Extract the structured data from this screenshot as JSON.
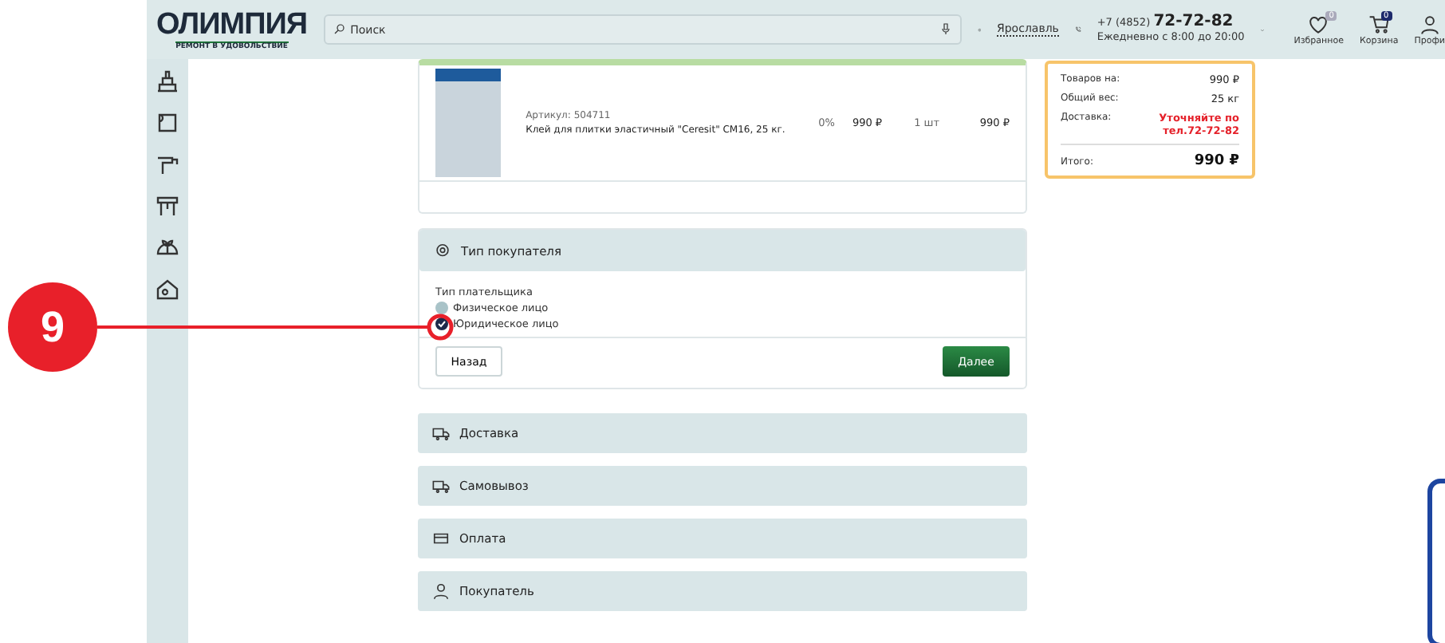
{
  "header": {
    "logo": "ОЛИМПИЯ",
    "tagline": "РЕМОНТ В УДОВОЛЬСТВИЕ",
    "search": {
      "placeholder": "Поиск"
    },
    "city": "Ярославль",
    "phone_prefix": "+7 (4852)",
    "phone": "72-72-82",
    "hours": "Ежедневно с 8:00 до 20:00",
    "actions": [
      {
        "kind": "favorites",
        "label": "Избранное",
        "badge": "0"
      },
      {
        "kind": "cart",
        "label": "Корзина",
        "badge": "0"
      },
      {
        "kind": "profile",
        "label": "Профи"
      }
    ]
  },
  "sidebar": {
    "items": [
      {
        "kind": "bricks"
      },
      {
        "kind": "wallpaper"
      },
      {
        "kind": "faucet"
      },
      {
        "kind": "tools"
      },
      {
        "kind": "garden"
      },
      {
        "kind": "house"
      }
    ]
  },
  "product": {
    "article": "Артикул: 504711",
    "name": "Клей для плитки эластичный \"Ceresit\" CM16, 25 кг.",
    "discount": "0%",
    "price": "990 ₽",
    "quantity": "1 шт",
    "total": "990 ₽"
  },
  "buyer_section": {
    "title": "Тип покупателя",
    "payer_label": "Тип плательщика",
    "options": [
      {
        "label": "Физическое лицо",
        "selected": false
      },
      {
        "label": "Юридическое лицо",
        "selected": true
      }
    ],
    "back_button": "Назад",
    "next_button": "Далее"
  },
  "sections": [
    {
      "kind": "truck",
      "title": "Доставка"
    },
    {
      "kind": "truck",
      "title": "Самовывоз"
    },
    {
      "kind": "card",
      "title": "Оплата"
    },
    {
      "kind": "person",
      "title": "Покупатель"
    }
  ],
  "summary": {
    "rows": [
      {
        "label": "Товаров на:",
        "value": "990 ₽",
        "kind": "normal"
      },
      {
        "label": "Общий вес:",
        "value": "25 кг",
        "kind": "normal"
      },
      {
        "label": "Доставка:",
        "value": "Уточняйте по тел.72-72-82",
        "kind": "alert"
      }
    ],
    "total_label": "Итого:",
    "total_value": "990 ₽"
  },
  "callout": {
    "number": "9"
  }
}
